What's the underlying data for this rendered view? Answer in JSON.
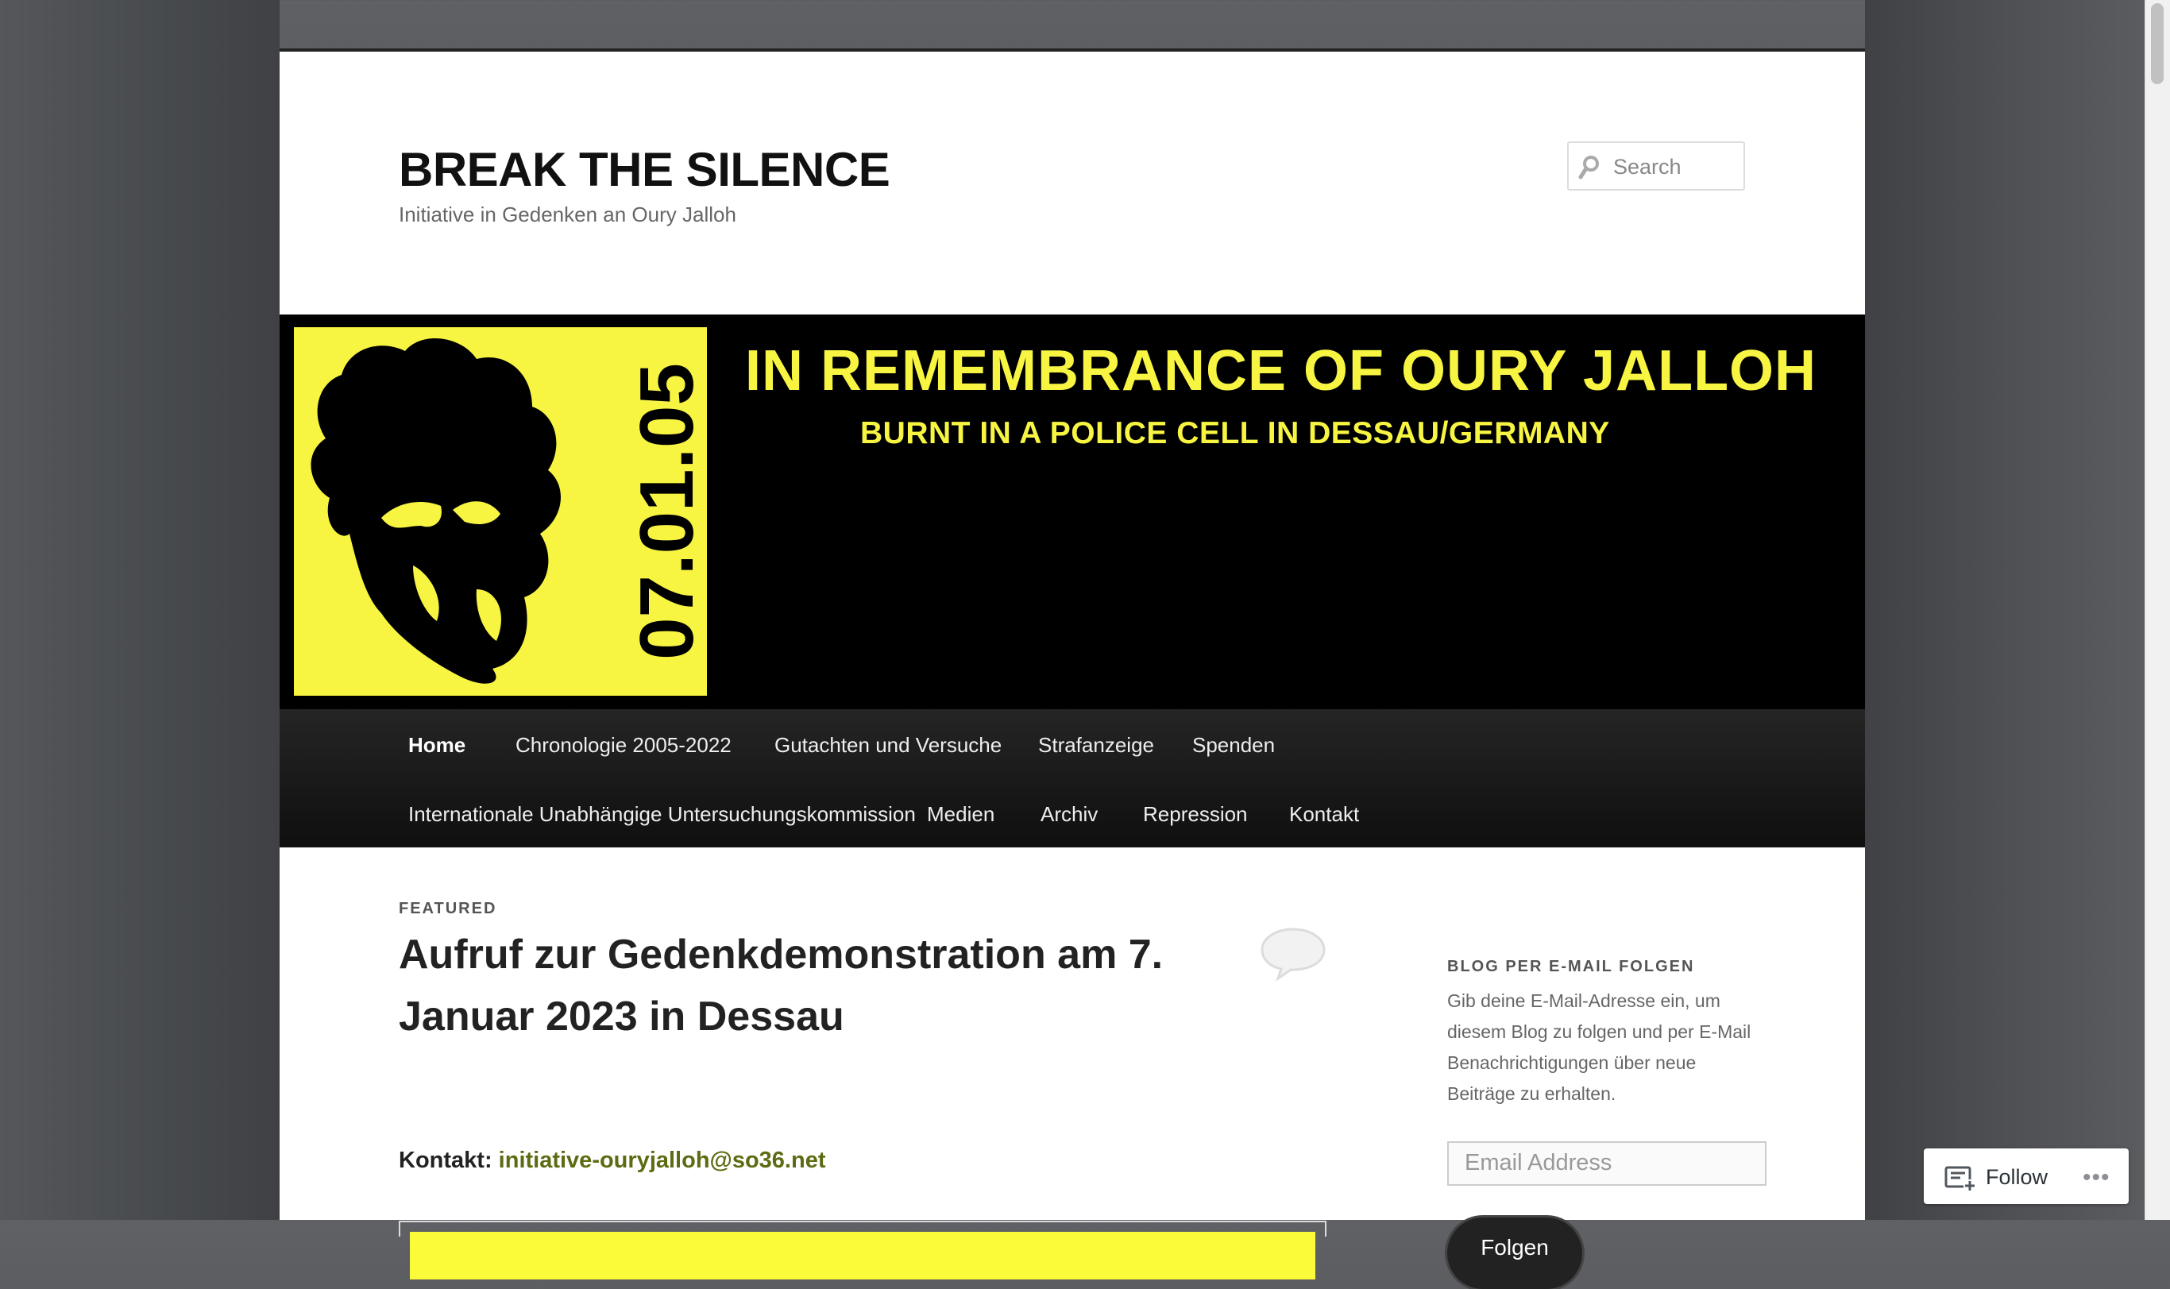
{
  "site": {
    "title": "BREAK THE SILENCE",
    "tagline": "Initiative in Gedenken an Oury Jalloh"
  },
  "search": {
    "placeholder": "Search",
    "icon": "search-icon"
  },
  "banner": {
    "headline": "IN REMEMBRANCE OF OURY JALLOH",
    "subline": "BURNT IN A POLICE CELL IN DESSAU/GERMANY",
    "date": "07.01.05",
    "accent_color": "#f7f542"
  },
  "nav": {
    "items": [
      {
        "label": "Home",
        "active": true
      },
      {
        "label": "Chronologie 2005-2022"
      },
      {
        "label": "Gutachten und Versuche"
      },
      {
        "label": "Strafanzeige"
      },
      {
        "label": "Spenden"
      },
      {
        "label": "Internationale Unabhängige Untersuchungskommission"
      },
      {
        "label": "Medien"
      },
      {
        "label": "Archiv"
      },
      {
        "label": "Repression"
      },
      {
        "label": "Kontakt"
      }
    ]
  },
  "post": {
    "label": "FEATURED",
    "title": "Aufruf zur Gedenkdemonstration am 7. Januar 2023 in Dessau",
    "contact_label": "Kontakt:",
    "contact_email": "initiative-ouryjalloh@so36.net",
    "link_color": "#5e6b12"
  },
  "widget": {
    "title": "BLOG PER E-MAIL FOLGEN",
    "text": "Gib deine E-Mail-Adresse ein, um diesem Blog zu folgen und per E-Mail Benachrichtigungen über neue Beiträge zu erhalten.",
    "email_placeholder": "Email Address",
    "button": "Folgen"
  },
  "follow": {
    "label": "Follow",
    "more": "•••"
  }
}
